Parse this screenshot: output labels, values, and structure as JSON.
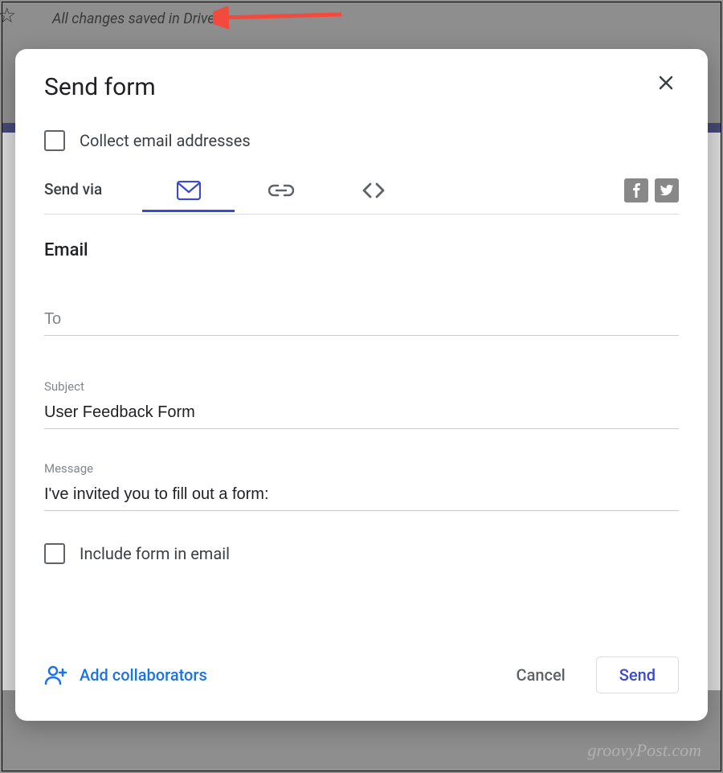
{
  "background": {
    "saved_text": "All changes saved in Drive",
    "watermark": "groovyPost.com"
  },
  "dialog": {
    "title": "Send form",
    "collect_label": "Collect email addresses",
    "send_via_label": "Send via",
    "section_title": "Email",
    "to_placeholder": "To",
    "subject_label": "Subject",
    "subject_value": "User Feedback Form",
    "message_label": "Message",
    "message_value": "I've invited you to fill out a form:",
    "include_label": "Include form in email",
    "add_collab_label": "Add collaborators",
    "cancel_label": "Cancel",
    "send_label": "Send"
  }
}
